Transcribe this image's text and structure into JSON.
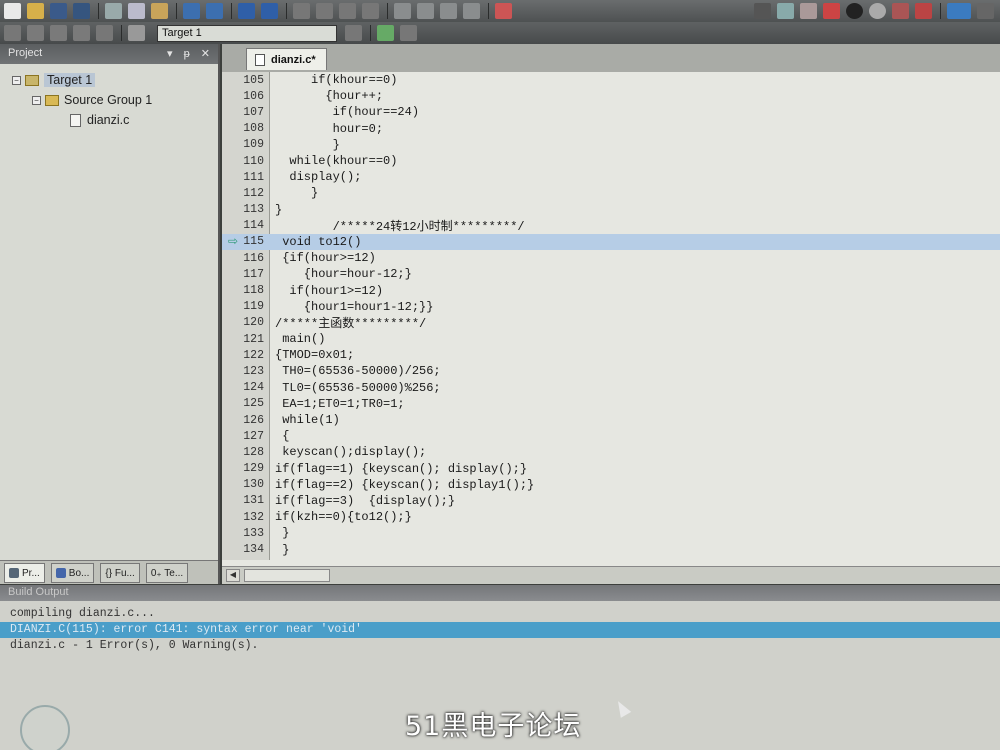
{
  "toolbar": {
    "target_value": "Target 1"
  },
  "project": {
    "title": "Project",
    "header_icons": [
      "▾",
      "ᵽ",
      "✕"
    ],
    "tree": {
      "target": "Target 1",
      "group": "Source Group 1",
      "file": "dianzi.c"
    },
    "tabs": [
      "Pr...",
      "Bo...",
      "{} Fu...",
      "0₊ Te..."
    ]
  },
  "editor": {
    "tab_label": "dianzi.c*",
    "current_line": 115,
    "lines": [
      {
        "n": "105",
        "t": "     if(khour==0)"
      },
      {
        "n": "106",
        "t": "       {hour++;"
      },
      {
        "n": "107",
        "t": "        if(hour==24)"
      },
      {
        "n": "108",
        "t": "        hour=0;"
      },
      {
        "n": "109",
        "t": "        }"
      },
      {
        "n": "110",
        "t": "  while(khour==0)"
      },
      {
        "n": "111",
        "t": "  display();"
      },
      {
        "n": "112",
        "t": "     }"
      },
      {
        "n": "113",
        "t": "}"
      },
      {
        "n": "114",
        "t": "        /*****24转12小时制*********/"
      },
      {
        "n": "115",
        "t": " void to12()"
      },
      {
        "n": "116",
        "t": " {if(hour>=12)"
      },
      {
        "n": "117",
        "t": "    {hour=hour-12;}"
      },
      {
        "n": "118",
        "t": "  if(hour1>=12)"
      },
      {
        "n": "119",
        "t": "    {hour1=hour1-12;}}"
      },
      {
        "n": "120",
        "t": "/*****主函数*********/"
      },
      {
        "n": "121",
        "t": " main()"
      },
      {
        "n": "122",
        "t": "{TMOD=0x01;"
      },
      {
        "n": "123",
        "t": " TH0=(65536-50000)/256;"
      },
      {
        "n": "124",
        "t": " TL0=(65536-50000)%256;"
      },
      {
        "n": "125",
        "t": " EA=1;ET0=1;TR0=1;"
      },
      {
        "n": "126",
        "t": " while(1)"
      },
      {
        "n": "127",
        "t": " {"
      },
      {
        "n": "128",
        "t": " keyscan();display();"
      },
      {
        "n": "129",
        "t": "if(flag==1) {keyscan(); display();}"
      },
      {
        "n": "130",
        "t": "if(flag==2) {keyscan(); display1();}"
      },
      {
        "n": "131",
        "t": "if(flag==3)  {display();}"
      },
      {
        "n": "132",
        "t": "if(kzh==0){to12();}"
      },
      {
        "n": "133",
        "t": " }"
      },
      {
        "n": "134",
        "t": " }"
      }
    ]
  },
  "build": {
    "title": "Build Output",
    "lines": [
      "compiling dianzi.c...",
      "DIANZI.C(115): error C141: syntax error near 'void'",
      "dianzi.c - 1 Error(s), 0 Warning(s)."
    ],
    "error_line_index": 1
  },
  "watermark": "51黑电子论坛",
  "colors": {
    "current_line": "#b6cde6",
    "error_highlight": "#4a9ec9",
    "exec_arrow": "#2f9a78"
  }
}
